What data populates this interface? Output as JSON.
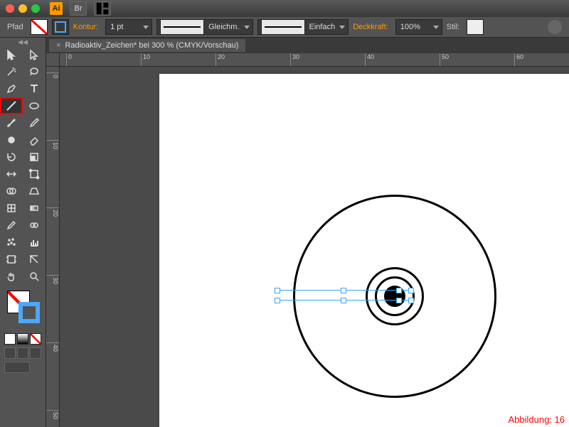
{
  "app": {
    "icon_text": "Ai"
  },
  "control": {
    "path_label": "Pfad",
    "kontur_label": "Kontur:",
    "stroke_weight": "1 pt",
    "profile_label": "Gleichm.",
    "brush_label": "Einfach",
    "opacity_label": "Deckkraft:",
    "opacity_value": "100%",
    "style_label": "Stil:"
  },
  "document": {
    "tab_title": "Radioaktiv_Zeichen* bei 300 % (CMYK/Vorschau)"
  },
  "ruler": {
    "h": [
      "0",
      "10",
      "20",
      "30",
      "40",
      "50",
      "60"
    ],
    "v": [
      "0",
      "10",
      "20",
      "30",
      "40",
      "50"
    ]
  },
  "caption": "Abbildung: 16",
  "tools": [
    [
      "selection",
      "direct-selection"
    ],
    [
      "magic-wand",
      "lasso"
    ],
    [
      "pen",
      "type"
    ],
    [
      "line",
      "ellipse"
    ],
    [
      "brush",
      "pencil"
    ],
    [
      "blob",
      "eraser"
    ],
    [
      "rotate",
      "scale"
    ],
    [
      "width",
      "free-transform"
    ],
    [
      "shape-builder",
      "perspective"
    ],
    [
      "mesh",
      "gradient"
    ],
    [
      "eyedropper",
      "blend"
    ],
    [
      "symbol-spray",
      "graph"
    ],
    [
      "artboard",
      "slice"
    ],
    [
      "hand",
      "zoom"
    ]
  ]
}
